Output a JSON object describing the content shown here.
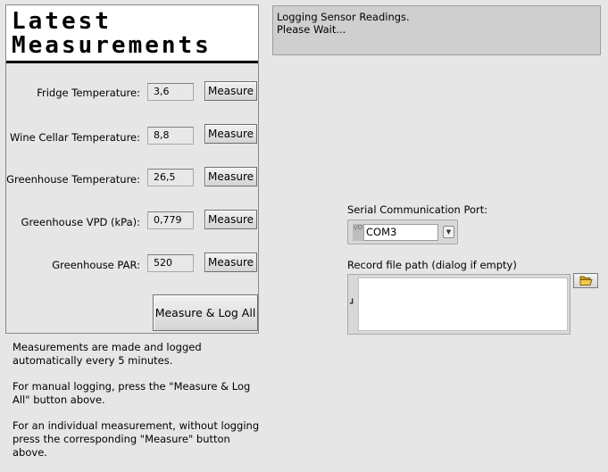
{
  "panel": {
    "title_line1": "Latest",
    "title_line2": "Measurements",
    "rows": [
      {
        "label": "Fridge Temperature:",
        "value": "3,6",
        "button": "Measure"
      },
      {
        "label": "Wine Cellar Temperature:",
        "value": "8,8",
        "button": "Measure"
      },
      {
        "label": "Greenhouse Temperature:",
        "value": "26,5",
        "button": "Measure"
      },
      {
        "label": "Greenhouse VPD (kPa):",
        "value": "0,779",
        "button": "Measure"
      },
      {
        "label": "Greenhouse PAR:",
        "value": "520",
        "button": "Measure"
      }
    ],
    "measure_all_label": "Measure & Log All"
  },
  "instructions": {
    "p1": "Measurements are made and logged automatically every 5 minutes.",
    "p2": "For manual logging, press the \"Measure & Log All\" button above.",
    "p3": "For an individual measurement, without logging press the corresponding \"Measure\" button above."
  },
  "status": {
    "line1": "Logging Sensor Readings.",
    "line2": "Please Wait..."
  },
  "serial": {
    "label": "Serial Communication Port:",
    "io_icon": "I/O",
    "value": "COM3"
  },
  "record": {
    "label": "Record file path (dialog if empty)",
    "value": ""
  },
  "icons": {
    "dropdown": "chevron-down-icon",
    "path": "path-icon",
    "browse": "folder-open-icon"
  }
}
